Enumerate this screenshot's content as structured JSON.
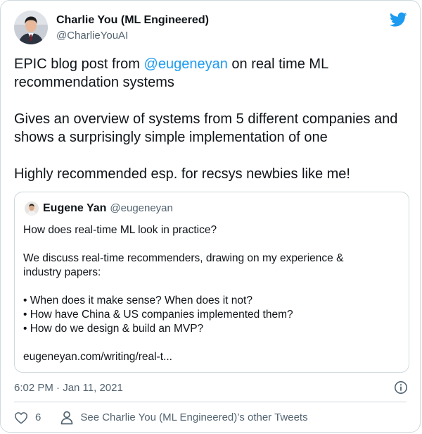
{
  "tweet": {
    "author_name": "Charlie You (ML Engineered)",
    "author_handle": "@CharlieYouAI",
    "text_part1": "EPIC blog post from ",
    "mention": "@eugeneyan",
    "text_part2": " on real time ML recommendation systems",
    "paragraph2": "Gives an overview of systems from 5 different companies and shows a surprisingly simple implementation of one",
    "paragraph3": "Highly recommended esp. for recsys newbies like me!",
    "timestamp": "6:02 PM · Jan 11, 2021"
  },
  "quoted": {
    "author_name": "Eugene Yan",
    "author_handle": "@eugeneyan",
    "line1": "How does real-time ML look in practice?",
    "line2": "We discuss real-time recommenders, drawing on my experience &",
    "line3": "industry papers:",
    "bullet1": "• When does it make sense? When does it not?",
    "bullet2": "• How have China & US companies implemented them?",
    "bullet3": "• How do we design & build an MVP?",
    "link": "eugeneyan.com/writing/real-t..."
  },
  "actions": {
    "like_count": "6",
    "other_tweets_label": "See Charlie You (ML Engineered)’s other Tweets"
  },
  "icons": {
    "brand": "twitter-bird-icon",
    "info": "info-icon",
    "like": "heart-icon",
    "profile": "person-icon"
  },
  "colors": {
    "accent": "#1d9bf0",
    "text": "#0f1419",
    "secondary": "#536471",
    "border": "#cfd9de"
  }
}
